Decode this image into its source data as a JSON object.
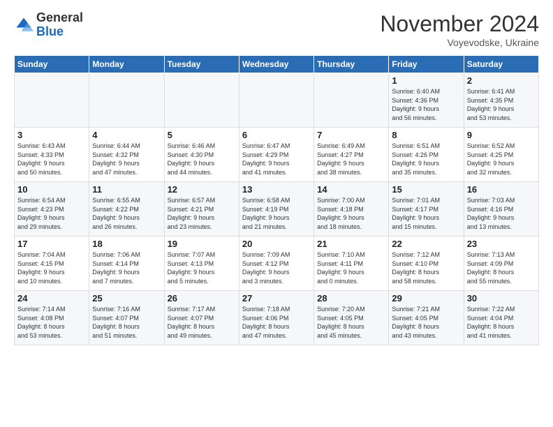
{
  "logo": {
    "general": "General",
    "blue": "Blue"
  },
  "header": {
    "month": "November 2024",
    "location": "Voyevodske, Ukraine"
  },
  "weekdays": [
    "Sunday",
    "Monday",
    "Tuesday",
    "Wednesday",
    "Thursday",
    "Friday",
    "Saturday"
  ],
  "weeks": [
    [
      {
        "day": "",
        "info": ""
      },
      {
        "day": "",
        "info": ""
      },
      {
        "day": "",
        "info": ""
      },
      {
        "day": "",
        "info": ""
      },
      {
        "day": "",
        "info": ""
      },
      {
        "day": "1",
        "info": "Sunrise: 6:40 AM\nSunset: 4:36 PM\nDaylight: 9 hours\nand 56 minutes."
      },
      {
        "day": "2",
        "info": "Sunrise: 6:41 AM\nSunset: 4:35 PM\nDaylight: 9 hours\nand 53 minutes."
      }
    ],
    [
      {
        "day": "3",
        "info": "Sunrise: 6:43 AM\nSunset: 4:33 PM\nDaylight: 9 hours\nand 50 minutes."
      },
      {
        "day": "4",
        "info": "Sunrise: 6:44 AM\nSunset: 4:32 PM\nDaylight: 9 hours\nand 47 minutes."
      },
      {
        "day": "5",
        "info": "Sunrise: 6:46 AM\nSunset: 4:30 PM\nDaylight: 9 hours\nand 44 minutes."
      },
      {
        "day": "6",
        "info": "Sunrise: 6:47 AM\nSunset: 4:29 PM\nDaylight: 9 hours\nand 41 minutes."
      },
      {
        "day": "7",
        "info": "Sunrise: 6:49 AM\nSunset: 4:27 PM\nDaylight: 9 hours\nand 38 minutes."
      },
      {
        "day": "8",
        "info": "Sunrise: 6:51 AM\nSunset: 4:26 PM\nDaylight: 9 hours\nand 35 minutes."
      },
      {
        "day": "9",
        "info": "Sunrise: 6:52 AM\nSunset: 4:25 PM\nDaylight: 9 hours\nand 32 minutes."
      }
    ],
    [
      {
        "day": "10",
        "info": "Sunrise: 6:54 AM\nSunset: 4:23 PM\nDaylight: 9 hours\nand 29 minutes."
      },
      {
        "day": "11",
        "info": "Sunrise: 6:55 AM\nSunset: 4:22 PM\nDaylight: 9 hours\nand 26 minutes."
      },
      {
        "day": "12",
        "info": "Sunrise: 6:57 AM\nSunset: 4:21 PM\nDaylight: 9 hours\nand 23 minutes."
      },
      {
        "day": "13",
        "info": "Sunrise: 6:58 AM\nSunset: 4:19 PM\nDaylight: 9 hours\nand 21 minutes."
      },
      {
        "day": "14",
        "info": "Sunrise: 7:00 AM\nSunset: 4:18 PM\nDaylight: 9 hours\nand 18 minutes."
      },
      {
        "day": "15",
        "info": "Sunrise: 7:01 AM\nSunset: 4:17 PM\nDaylight: 9 hours\nand 15 minutes."
      },
      {
        "day": "16",
        "info": "Sunrise: 7:03 AM\nSunset: 4:16 PM\nDaylight: 9 hours\nand 13 minutes."
      }
    ],
    [
      {
        "day": "17",
        "info": "Sunrise: 7:04 AM\nSunset: 4:15 PM\nDaylight: 9 hours\nand 10 minutes."
      },
      {
        "day": "18",
        "info": "Sunrise: 7:06 AM\nSunset: 4:14 PM\nDaylight: 9 hours\nand 7 minutes."
      },
      {
        "day": "19",
        "info": "Sunrise: 7:07 AM\nSunset: 4:13 PM\nDaylight: 9 hours\nand 5 minutes."
      },
      {
        "day": "20",
        "info": "Sunrise: 7:09 AM\nSunset: 4:12 PM\nDaylight: 9 hours\nand 3 minutes."
      },
      {
        "day": "21",
        "info": "Sunrise: 7:10 AM\nSunset: 4:11 PM\nDaylight: 9 hours\nand 0 minutes."
      },
      {
        "day": "22",
        "info": "Sunrise: 7:12 AM\nSunset: 4:10 PM\nDaylight: 8 hours\nand 58 minutes."
      },
      {
        "day": "23",
        "info": "Sunrise: 7:13 AM\nSunset: 4:09 PM\nDaylight: 8 hours\nand 55 minutes."
      }
    ],
    [
      {
        "day": "24",
        "info": "Sunrise: 7:14 AM\nSunset: 4:08 PM\nDaylight: 8 hours\nand 53 minutes."
      },
      {
        "day": "25",
        "info": "Sunrise: 7:16 AM\nSunset: 4:07 PM\nDaylight: 8 hours\nand 51 minutes."
      },
      {
        "day": "26",
        "info": "Sunrise: 7:17 AM\nSunset: 4:07 PM\nDaylight: 8 hours\nand 49 minutes."
      },
      {
        "day": "27",
        "info": "Sunrise: 7:18 AM\nSunset: 4:06 PM\nDaylight: 8 hours\nand 47 minutes."
      },
      {
        "day": "28",
        "info": "Sunrise: 7:20 AM\nSunset: 4:05 PM\nDaylight: 8 hours\nand 45 minutes."
      },
      {
        "day": "29",
        "info": "Sunrise: 7:21 AM\nSunset: 4:05 PM\nDaylight: 8 hours\nand 43 minutes."
      },
      {
        "day": "30",
        "info": "Sunrise: 7:22 AM\nSunset: 4:04 PM\nDaylight: 8 hours\nand 41 minutes."
      }
    ]
  ]
}
